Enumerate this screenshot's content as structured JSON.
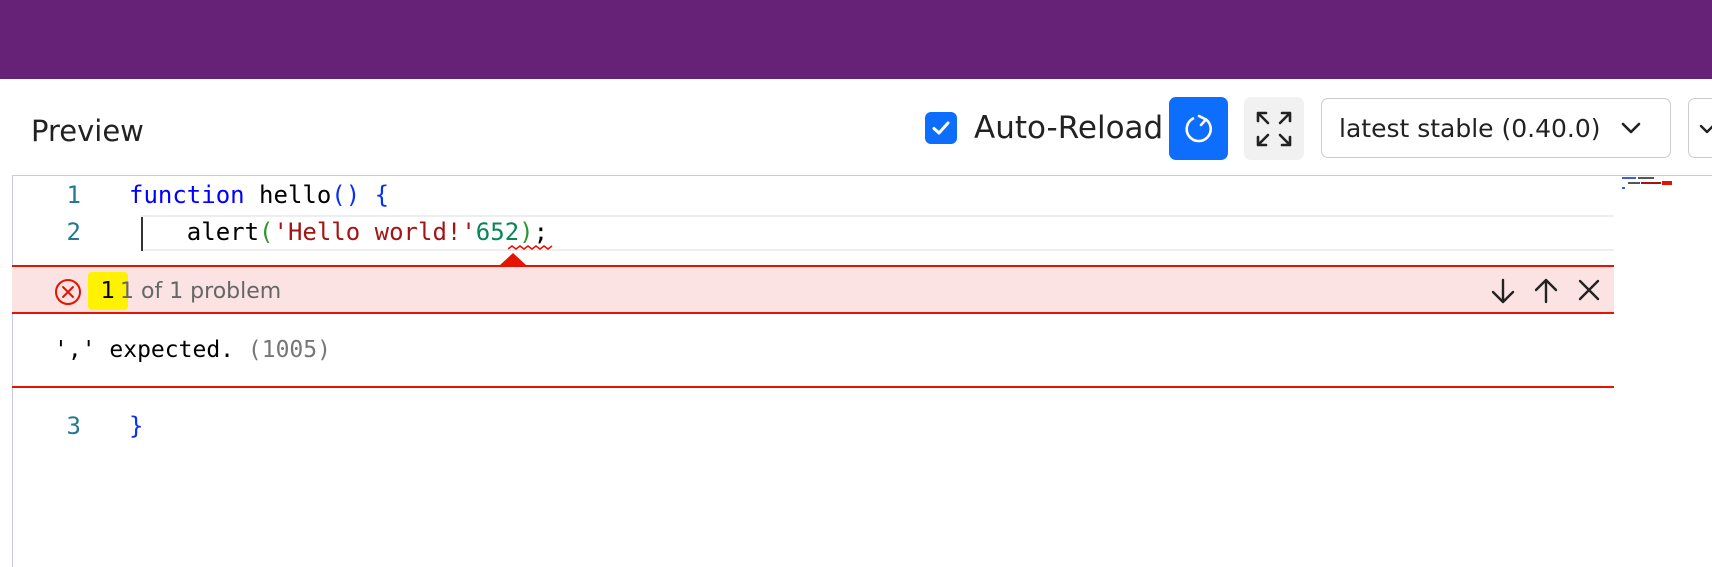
{
  "app": {
    "preview_title": "Preview",
    "autoreload_label": "Auto-Reload",
    "autoreload_checked": true,
    "version_selected": "latest stable (0.40.0)",
    "colors": {
      "topbar": "#662277",
      "accent": "#0d6efd",
      "error": "#e51400"
    }
  },
  "editor": {
    "lines": [
      {
        "number": "1",
        "tokens": [
          "function",
          " hello",
          "()",
          " {"
        ]
      },
      {
        "number": "2",
        "tokens": [
          "    alert",
          "(",
          "'Hello world!'",
          "652",
          ")",
          ";"
        ]
      },
      {
        "number": "3",
        "tokens": [
          "}"
        ]
      }
    ]
  },
  "problem": {
    "count": "1",
    "summary": "1 of 1 problem",
    "message": "',' expected.",
    "code": "(1005)",
    "icons": [
      "error-circle-icon",
      "arrow-down-icon",
      "arrow-up-icon",
      "close-icon"
    ]
  }
}
